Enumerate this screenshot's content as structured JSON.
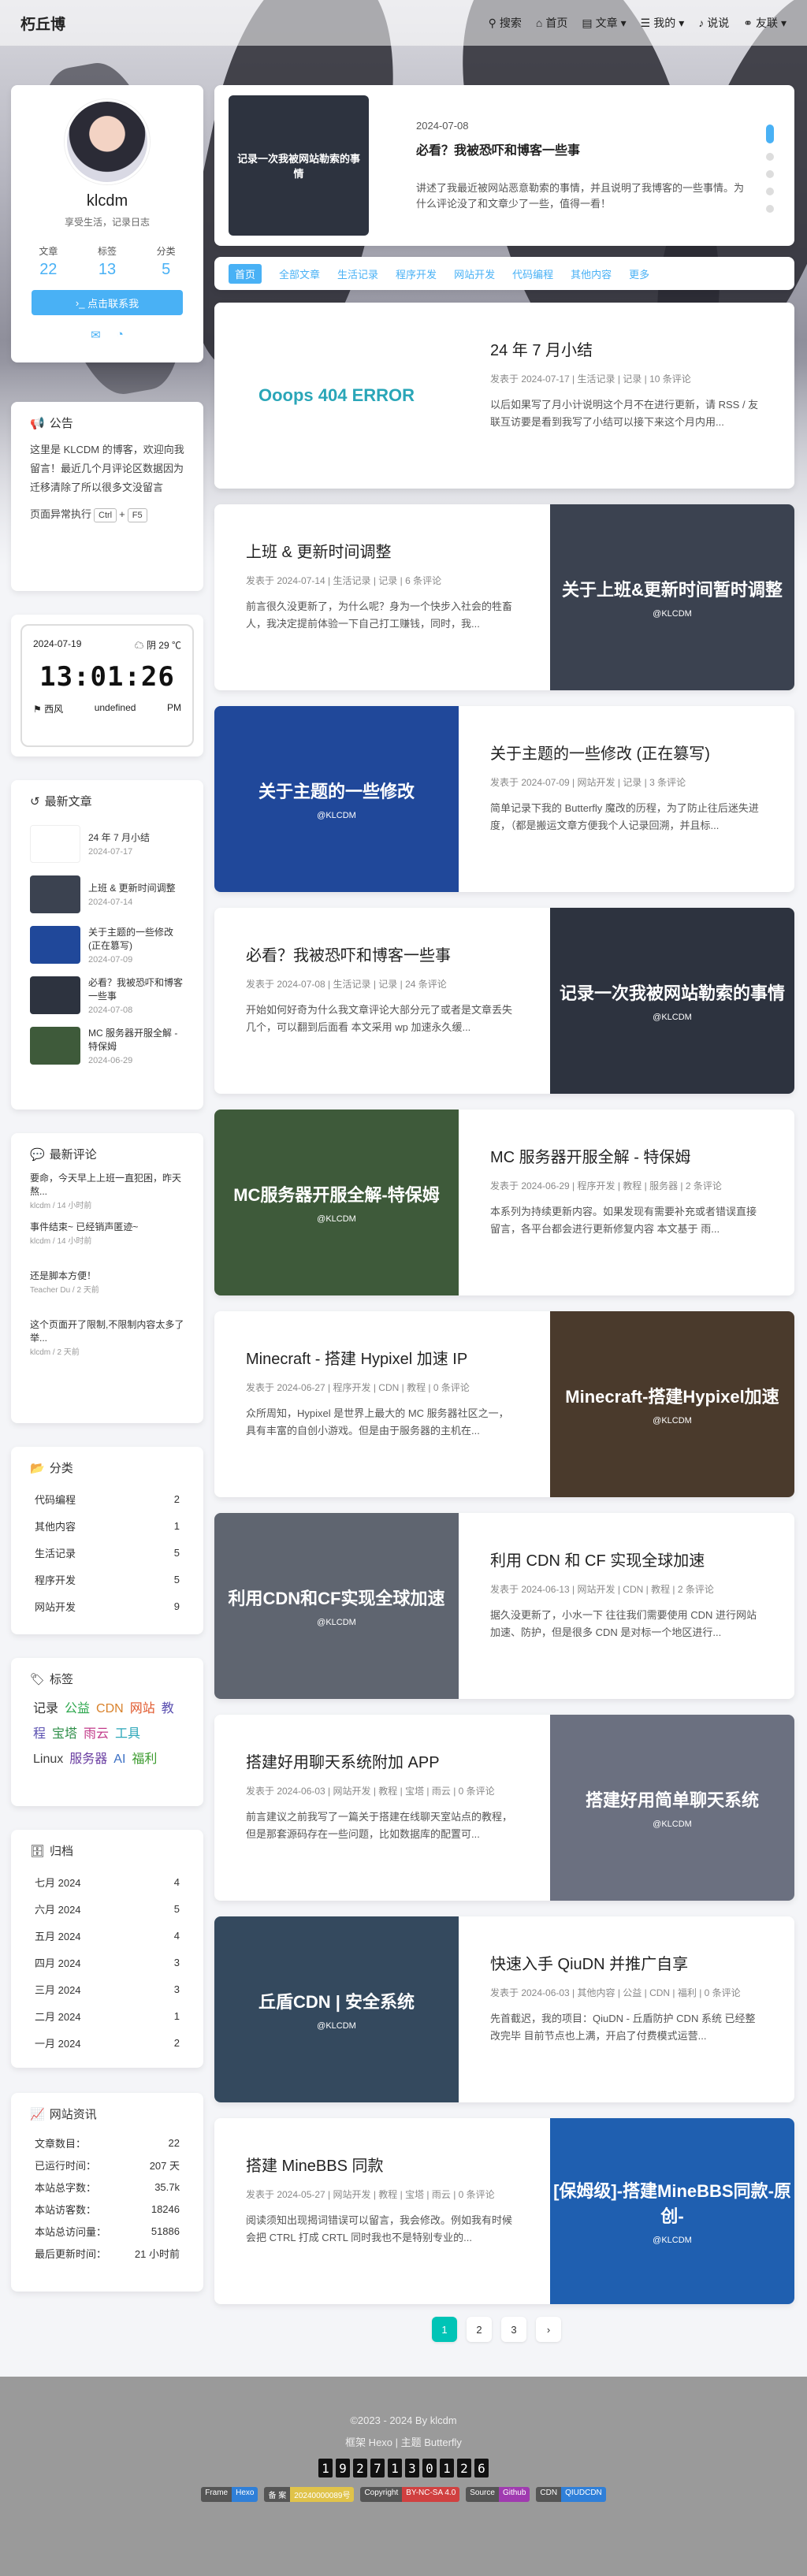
{
  "nav": {
    "brand": "朽丘博",
    "menus": [
      "搜索",
      "首页",
      "文章",
      "我的",
      "说说",
      "友联"
    ]
  },
  "profile": {
    "name": "klcdm",
    "desc": "享受生活，记录日志",
    "stats": [
      {
        "label": "文章",
        "value": "22"
      },
      {
        "label": "标签",
        "value": "13"
      },
      {
        "label": "分类",
        "value": "5"
      }
    ],
    "follow": "点击联系我"
  },
  "notice": {
    "title": "公告",
    "text": "这里是 KLCDM 的博客，欢迎向我留言！最近几个月评论区数据因为迁移清除了所以很多文没留言",
    "status": "页面异常执行",
    "keys": [
      "Ctrl",
      "F5"
    ]
  },
  "clock": {
    "date": "2024-07-19",
    "weather": "阴 29 ℃",
    "time": "13:01:26",
    "wind": "西风",
    "wind_level": "undefined",
    "ampm": "PM"
  },
  "recent": {
    "title": "最新文章",
    "items": [
      {
        "title": "24 年 7 月小结",
        "date": "2024-07-17",
        "color": "#ffffff"
      },
      {
        "title": "上班 & 更新时间调整",
        "date": "2024-07-14",
        "color": "#3b4250"
      },
      {
        "title": "关于主题的一些修改 (正在篡写)",
        "date": "2024-07-09",
        "color": "#20489a"
      },
      {
        "title": "必看？我被恐吓和博客一些事",
        "date": "2024-07-08",
        "color": "#2d333f"
      },
      {
        "title": "MC 服务器开服全解 - 特保姆",
        "date": "2024-06-29",
        "color": "#3e5a3a"
      }
    ]
  },
  "comments": {
    "title": "最新评论",
    "items": [
      {
        "text": "要命，今天早上上班一直犯困，昨天熬...",
        "meta": "klcdm / 14 小时前"
      },
      {
        "text": "事件结束~ 已经销声匿迹~",
        "meta": "klcdm / 14 小时前"
      },
      {
        "text": "还是脚本方便！",
        "meta": "Teacher Du / 2 天前"
      },
      {
        "text": "这个页面开了限制,不限制内容太多了举...",
        "meta": "klcdm / 2 天前"
      }
    ]
  },
  "categories": {
    "title": "分类",
    "items": [
      {
        "name": "代码编程",
        "count": "2"
      },
      {
        "name": "其他内容",
        "count": "1"
      },
      {
        "name": "生活记录",
        "count": "5"
      },
      {
        "name": "程序开发",
        "count": "5"
      },
      {
        "name": "网站开发",
        "count": "9"
      }
    ]
  },
  "tags": {
    "title": "标签",
    "items": [
      {
        "name": "记录",
        "color": "#333333"
      },
      {
        "name": "公益",
        "color": "#2fa84f"
      },
      {
        "name": "CDN",
        "color": "#d9822b"
      },
      {
        "name": "网站",
        "color": "#e0572b"
      },
      {
        "name": "教程",
        "color": "#5a4fb0"
      },
      {
        "name": "宝塔",
        "color": "#2f8f4a"
      },
      {
        "name": "雨云",
        "color": "#c23b8a"
      },
      {
        "name": "工具",
        "color": "#2aa6b8"
      },
      {
        "name": "Linux",
        "color": "#444444"
      },
      {
        "name": "服务器",
        "color": "#6a3ea1"
      },
      {
        "name": "AI",
        "color": "#3a6fc4"
      },
      {
        "name": "福利",
        "color": "#3c9b2f"
      }
    ]
  },
  "archive": {
    "title": "归档",
    "items": [
      {
        "name": "七月 2024",
        "count": "4"
      },
      {
        "name": "六月 2024",
        "count": "5"
      },
      {
        "name": "五月 2024",
        "count": "4"
      },
      {
        "name": "四月 2024",
        "count": "3"
      },
      {
        "name": "三月 2024",
        "count": "3"
      },
      {
        "name": "二月 2024",
        "count": "1"
      },
      {
        "name": "一月 2024",
        "count": "2"
      }
    ]
  },
  "siteinfo": {
    "title": "网站资讯",
    "items": [
      {
        "name": "文章数目：",
        "value": "22"
      },
      {
        "name": "已运行时间：",
        "value": "207 天"
      },
      {
        "name": "本站总字数：",
        "value": "35.7k"
      },
      {
        "name": "本站访客数：",
        "value": "18246"
      },
      {
        "name": "本站总访问量：",
        "value": "51886"
      },
      {
        "name": "最后更新时间：",
        "value": "21 小时前"
      }
    ]
  },
  "banner": {
    "img_text": "记录一次我被网站勒索的事情",
    "date": "2024-07-08",
    "title": "必看？我被恐吓和博客一些事",
    "excerpt": "讲述了我最近被网站恶意勒索的事情，并且说明了我博客的一些事情。为什么评论没了和文章少了一些，值得一看！"
  },
  "tabs": [
    "首页",
    "全部文章",
    "生活记录",
    "程序开发",
    "网站开发",
    "代码编程",
    "其他内容",
    "更多"
  ],
  "posts": [
    {
      "title": "24 年 7 月小结",
      "meta": "发表于 2024-07-17 | 生活记录 | 记录 | 10 条评论",
      "excerpt": "以后如果写了月小计说明这个月不在进行更新，请 RSS / 友联互访要是看到我写了小结可以接下来这个月内用...",
      "img": "Ooops 404 ERROR",
      "color": "#ffffff",
      "textcolor": "#2aa6b8"
    },
    {
      "title": "上班 & 更新时间调整",
      "meta": "发表于 2024-07-14 | 生活记录 | 记录 | 6 条评论",
      "excerpt": "前言很久没更新了，为什么呢？身为一个快步入社会的牲畜人，我决定提前体验一下自己打工赚钱，同时，我...",
      "img": "关于上班&更新时间暂时调整",
      "color": "#3b4250",
      "textcolor": "#ffffff"
    },
    {
      "title": "关于主题的一些修改 (正在篡写)",
      "meta": "发表于 2024-07-09 | 网站开发 | 记录 | 3 条评论",
      "excerpt": "简单记录下我的 Butterfly 魔改的历程，为了防止往后迷失进度，（都是搬运文章方便我个人记录回溯，并且标...",
      "img": "关于主题的一些修改",
      "color": "#20489a",
      "textcolor": "#ffffff"
    },
    {
      "title": "必看？我被恐吓和博客一些事",
      "meta": "发表于 2024-07-08 | 生活记录 | 记录 | 24 条评论",
      "excerpt": "开始如何好奇为什么我文章评论大部分元了或者是文章丢失几个，可以翻到后面看 本文采用 wp 加速永久缓...",
      "img": "记录一次我被网站勒索的事情",
      "color": "#2d333f",
      "textcolor": "#ffffff"
    },
    {
      "title": "MC 服务器开服全解 - 特保姆",
      "meta": "发表于 2024-06-29 | 程序开发 | 教程 | 服务器 | 2 条评论",
      "excerpt": "本系列为持续更新内容。如果发现有需要补充或者错误直接留言，各平台都会进行更新修复内容 本文基于 雨...",
      "img": "MC服务器开服全解-特保姆",
      "color": "#3e5a3a",
      "textcolor": "#ffffff"
    },
    {
      "title": "Minecraft - 搭建 Hypixel 加速 IP",
      "meta": "发表于 2024-06-27 | 程序开发 | CDN | 教程 | 0 条评论",
      "excerpt": "众所周知，Hypixel 是世界上最大的 MC 服务器社区之一，具有丰富的自创小游戏。但是由于服务器的主机在...",
      "img": "Minecraft-搭建Hypixel加速",
      "color": "#4a3a2c",
      "textcolor": "#ffffff"
    },
    {
      "title": "利用 CDN 和 CF 实现全球加速",
      "meta": "发表于 2024-06-13 | 网站开发 | CDN | 教程 | 2 条评论",
      "excerpt": "据久没更新了，小水一下 往往我们需要使用 CDN 进行网站加速、防护，但是很多 CDN 是对标一个地区进行...",
      "img": "利用CDN和CF实现全球加速",
      "color": "#5f6570",
      "textcolor": "#ffffff"
    },
    {
      "title": "搭建好用聊天系统附加 APP",
      "meta": "发表于 2024-06-03 | 网站开发 | 教程 | 宝塔 | 雨云 | 0 条评论",
      "excerpt": "前言建议之前我写了一篇关于搭建在线聊天室站点的教程，但是那套源码存在一些问题，比如数据库的配置可...",
      "img": "搭建好用简单聊天系统",
      "color": "#6b7080",
      "textcolor": "#ffffff"
    },
    {
      "title": "快速入手 QiuDN 并推广自享",
      "meta": "发表于 2024-06-03 | 其他内容 | 公益 | CDN | 福利 | 0 条评论",
      "excerpt": "先首截迟，我的项目：QiuDN - 丘盾防护 CDN 系统 已经整改完毕 目前节点也上满，开启了付费模式运营...",
      "img": "丘盾CDN | 安全系统",
      "color": "#34495e",
      "textcolor": "#ffffff"
    },
    {
      "title": "搭建 MineBBS 同款",
      "meta": "发表于 2024-05-27 | 网站开发 | 教程 | 宝塔 | 雨云 | 0 条评论",
      "excerpt": "阅读须知出现揭词错误可以留言，我会修改。例如我有时候会把 CTRL 打成 CRTL 同时我也不是特别专业的...",
      "img": "[保姆级]-搭建MineBBS同款-原创-",
      "color": "#1f5fb0",
      "textcolor": "#ffffff"
    }
  ],
  "pager": [
    "1",
    "2",
    "3",
    "›"
  ],
  "footer": {
    "copyright": "©2023 - 2024 By klcdm",
    "framework": "框架 Hexo | 主题 Butterfly",
    "digits": [
      "1",
      "9",
      "2",
      "7",
      "1",
      "3",
      "0",
      "1",
      "2",
      "6"
    ],
    "badges": [
      {
        "k": "Frame",
        "v": "Hexo",
        "c": "#2f7fd8"
      },
      {
        "k": "备 案",
        "v": "20240000089号",
        "c": "#e0c34a"
      },
      {
        "k": "Copyright",
        "v": "BY-NC-SA 4.0",
        "c": "#d04040"
      },
      {
        "k": "Source",
        "v": "Github",
        "c": "#a03ab0"
      },
      {
        "k": "CDN",
        "v": "QIUDCDN",
        "c": "#2f7fd8"
      }
    ]
  }
}
